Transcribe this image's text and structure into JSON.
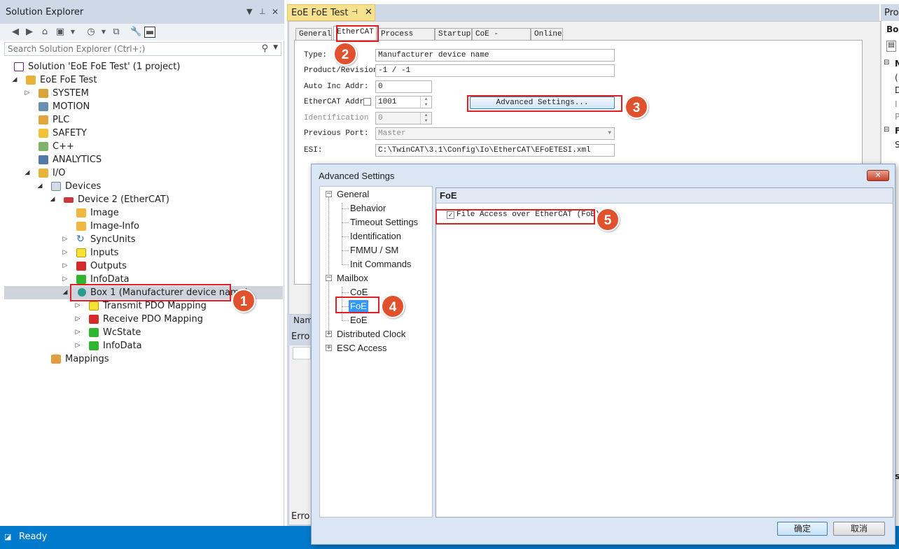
{
  "solution_explorer": {
    "title": "Solution Explorer",
    "search_placeholder": "Search Solution Explorer (Ctrl+;)",
    "tree": {
      "solution": "Solution 'EoE FoE Test' (1 project)",
      "project": "EoE FoE Test",
      "system": "SYSTEM",
      "motion": "MOTION",
      "plc": "PLC",
      "safety": "SAFETY",
      "cpp": "C++",
      "analytics": "ANALYTICS",
      "io": "I/O",
      "devices": "Devices",
      "device2": "Device 2 (EtherCAT)",
      "image": "Image",
      "image_info": "Image-Info",
      "syncunits": "SyncUnits",
      "inputs": "Inputs",
      "outputs": "Outputs",
      "infodata": "InfoData",
      "box1": "Box 1 (Manufacturer device name)",
      "transmit_pdo": "Transmit PDO Mapping",
      "receive_pdo": "Receive PDO Mapping",
      "wcstate": "WcState",
      "box_infodata": "InfoData",
      "mappings": "Mappings"
    }
  },
  "editor": {
    "doc_tab": "EoE FoE Test",
    "tabs": [
      "General",
      "EtherCAT",
      "Process Data",
      "Startup",
      "CoE - Online",
      "Online"
    ],
    "active_tab": "EtherCAT",
    "fields": {
      "type_label": "Type:",
      "type_value": "Manufacturer device name",
      "product_label": "Product/Revision",
      "product_value": "-1 / -1",
      "autoinc_label": "Auto Inc Addr:",
      "autoinc_value": "0",
      "ecat_label": "EtherCAT Addr:",
      "ecat_value": "1001",
      "ident_label": "Identification",
      "ident_value": "0",
      "prevport_label": "Previous Port:",
      "prevport_value": "Master",
      "esi_label": "ESI:",
      "esi_value": "C:\\TwinCAT\\3.1\\Config\\Io\\EtherCAT\\EFoETESI.xml"
    },
    "advanced_button": "Advanced Settings...",
    "cut_name": "Nam",
    "error_title": "Erro",
    "error_bottom": "Erro"
  },
  "properties": {
    "title": "Pro",
    "box": "Box",
    "fragments": [
      "M",
      "(",
      "D",
      "I",
      "P",
      "F",
      "S",
      "is"
    ]
  },
  "dialog": {
    "title": "Advanced Settings",
    "tree": {
      "general": "General",
      "behavior": "Behavior",
      "timeout": "Timeout Settings",
      "identification": "Identification",
      "fmmu": "FMMU / SM",
      "init": "Init Commands",
      "mailbox": "Mailbox",
      "coe": "CoE",
      "foe": "FoE",
      "eoe": "EoE",
      "dc": "Distributed Clock",
      "esc": "ESC Access"
    },
    "section_title": "FoE",
    "checkbox_label": "File Access over EtherCAT (FoE)",
    "checkbox_checked": true,
    "ok_button": "确定",
    "cancel_button": "取消"
  },
  "annotations": [
    "1",
    "2",
    "3",
    "4",
    "5"
  ],
  "status": {
    "text": "Ready"
  },
  "colors": {
    "accent": "#007acc",
    "callout": "#e0512d",
    "highlight": "#e41c24",
    "tab_active": "#f6e28e"
  }
}
